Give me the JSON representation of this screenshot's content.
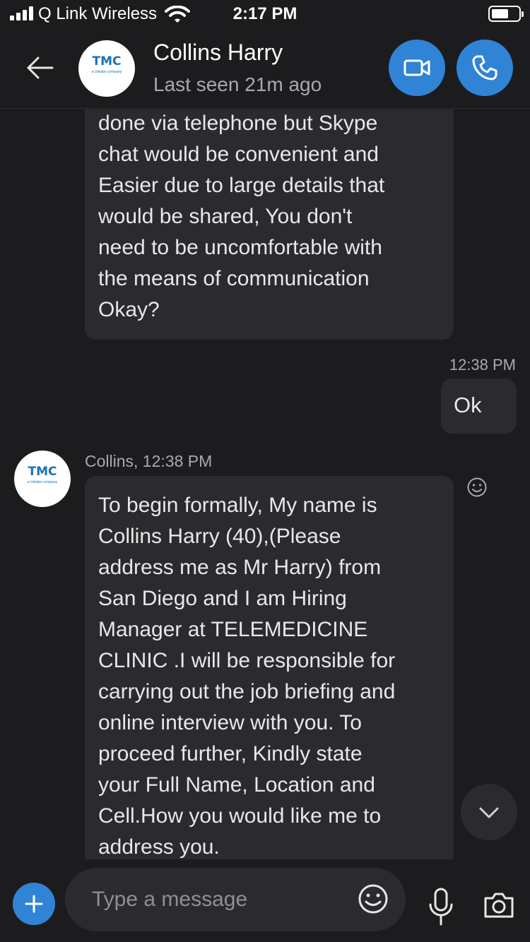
{
  "status_bar": {
    "carrier": "Q Link Wireless",
    "time": "2:17 PM"
  },
  "header": {
    "avatar_logo": "TMC",
    "avatar_sub": "a Unilabs company",
    "contact_name": "Collins Harry",
    "last_seen": "Last seen 21m ago",
    "video_icon": "video-camera-icon",
    "call_icon": "phone-icon"
  },
  "messages": [
    {
      "direction": "incoming",
      "text": "done via telephone but Skype\nchat would be convenient and\nEasier due to large details that\nwould be shared, You don't\nneed to be uncomfortable with\nthe means of communication\nOkay?"
    },
    {
      "direction": "outgoing",
      "timestamp": "12:38 PM",
      "text": "Ok"
    },
    {
      "direction": "incoming",
      "sender_meta": "Collins, 12:38 PM",
      "text": "To begin formally, My name is\nCollins Harry (40),(Please\naddress me as Mr Harry) from\nSan Diego and I am Hiring\nManager at TELEMEDICINE\nCLINIC .I will be responsible for\ncarrying out the job briefing and\nonline interview with you. To\nproceed further, Kindly state\nyour Full Name, Location and\nCell.How you would like me to\naddress you."
    }
  ],
  "composer": {
    "placeholder": "Type a message"
  },
  "colors": {
    "background": "#1c1c1e",
    "bubble": "#2b2b2f",
    "accent": "#2f84d6",
    "secondary_text": "#a9a9ad"
  }
}
